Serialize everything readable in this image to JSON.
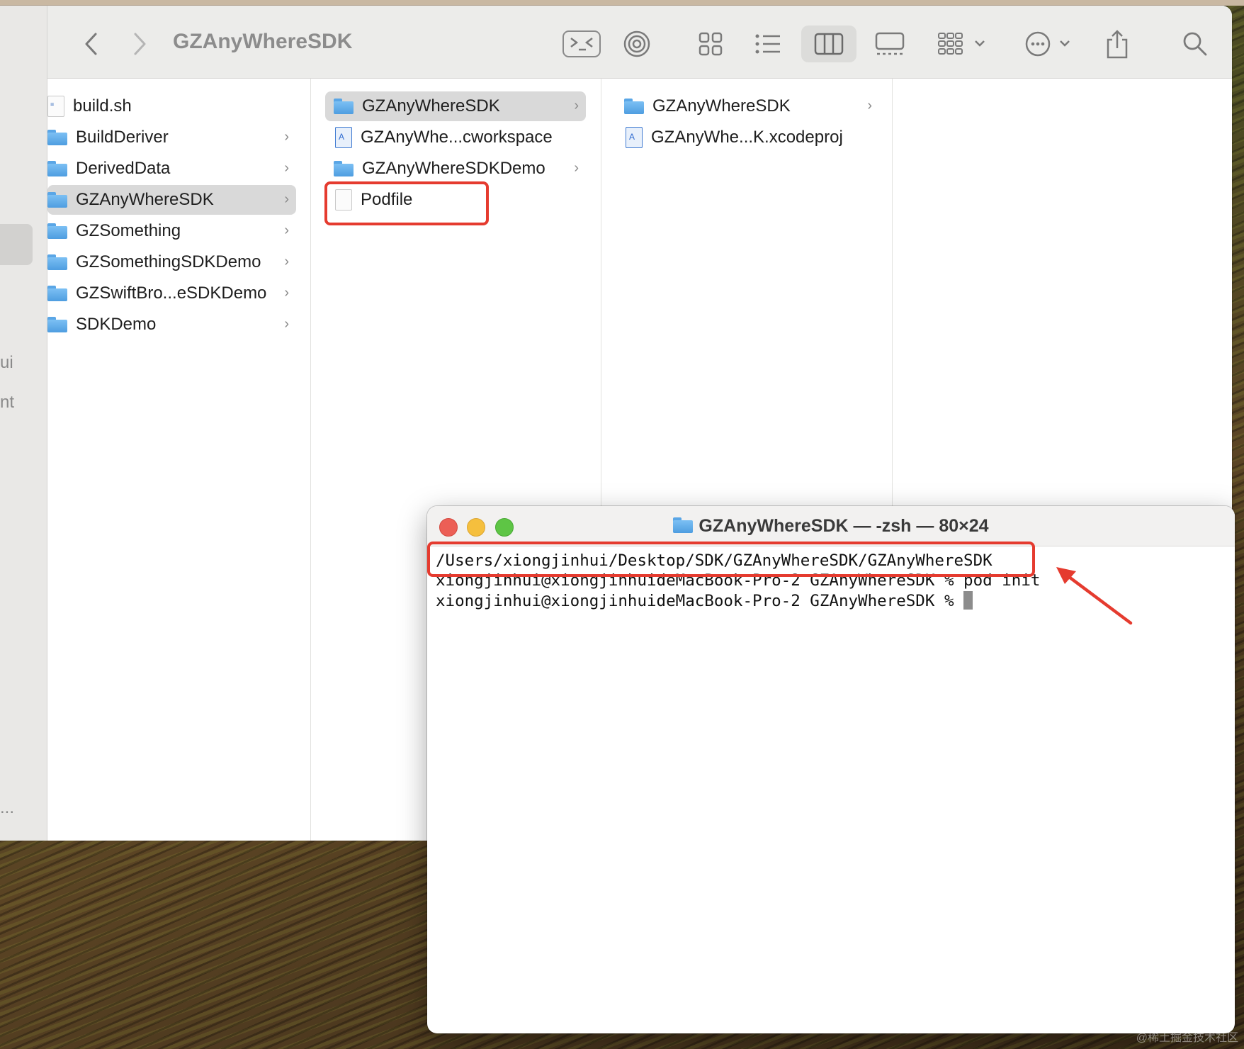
{
  "finder": {
    "title": "GZAnyWhereSDK",
    "sidebar_fragments": [
      "ui",
      "nt",
      "..."
    ],
    "toolbar_icons": [
      "back-icon",
      "forward-icon",
      "terminal-icon",
      "airdrop-icon",
      "icon-view-icon",
      "list-view-icon",
      "column-view-icon",
      "gallery-view-icon",
      "group-icon",
      "more-icon",
      "share-icon",
      "search-icon"
    ],
    "column1": [
      {
        "label": "build.sh",
        "icon": "shell-script-icon",
        "chevron": false
      },
      {
        "label": "BuildDeriver",
        "icon": "folder-icon",
        "chevron": true
      },
      {
        "label": "DerivedData",
        "icon": "folder-icon",
        "chevron": true
      },
      {
        "label": "GZAnyWhereSDK",
        "icon": "folder-icon",
        "chevron": true,
        "selected": true
      },
      {
        "label": "GZSomething",
        "icon": "folder-icon",
        "chevron": true
      },
      {
        "label": "GZSomethingSDKDemo",
        "icon": "folder-icon",
        "chevron": true
      },
      {
        "label": "GZSwiftBro...eSDKDemo",
        "icon": "folder-icon",
        "chevron": true
      },
      {
        "label": "SDKDemo",
        "icon": "folder-icon",
        "chevron": true
      }
    ],
    "column2": [
      {
        "label": "GZAnyWhereSDK",
        "icon": "folder-icon",
        "chevron": true,
        "selected": true
      },
      {
        "label": "GZAnyWhe...cworkspace",
        "icon": "workspace-icon",
        "chevron": false
      },
      {
        "label": "GZAnyWhereSDKDemo",
        "icon": "folder-icon",
        "chevron": true
      },
      {
        "label": "Podfile",
        "icon": "document-icon",
        "chevron": false,
        "highlighted": true
      }
    ],
    "column3": [
      {
        "label": "GZAnyWhereSDK",
        "icon": "folder-icon",
        "chevron": true
      },
      {
        "label": "GZAnyWhe...K.xcodeproj",
        "icon": "xcodeproj-icon",
        "chevron": false
      }
    ]
  },
  "terminal": {
    "title": "GZAnyWhereSDK — -zsh — 80×24",
    "lines": [
      "/Users/xiongjinhui/Desktop/SDK/GZAnyWhereSDK/GZAnyWhereSDK",
      "xiongjinhui@xiongjinhuideMacBook-Pro-2 GZAnyWhereSDK % pod init",
      "xiongjinhui@xiongjinhuideMacBook-Pro-2 GZAnyWhereSDK % "
    ]
  },
  "annotation_color": "#e53b2f",
  "watermark": "@稀土掘金技术社区"
}
